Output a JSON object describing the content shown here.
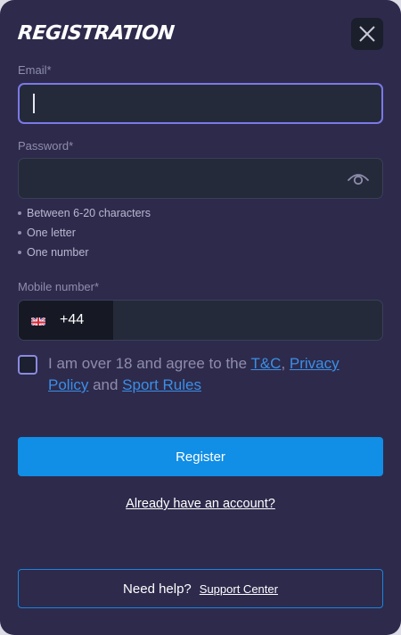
{
  "header": {
    "title": "REGISTRATION",
    "close_icon": "close-icon"
  },
  "email": {
    "label": "Email*",
    "value": "",
    "placeholder": ""
  },
  "password": {
    "label": "Password*",
    "value": "",
    "placeholder": "",
    "toggle_icon": "eye-icon",
    "rules": [
      "Between 6-20 characters",
      "One letter",
      "One number"
    ]
  },
  "mobile": {
    "label": "Mobile number*",
    "country_flag": "uk-flag-icon",
    "prefix": "+44",
    "value": "",
    "placeholder": ""
  },
  "terms": {
    "checked": false,
    "text_before": "I am over 18 and agree to the ",
    "tc_link": "T&C",
    "comma": ", ",
    "privacy_link": "Privacy Policy",
    "and_text": " and ",
    "sport_rules_link": "Sport Rules"
  },
  "actions": {
    "register_label": "Register",
    "account_link": "Already have an account?"
  },
  "help": {
    "text": "Need help?",
    "support_link": "Support Center"
  },
  "colors": {
    "background": "#2d2a4c",
    "input_bg": "#252a3a",
    "focus_border": "#7b79e6",
    "primary_button": "#118ee6",
    "link": "#3b8fe6",
    "label": "#8f8dad"
  }
}
